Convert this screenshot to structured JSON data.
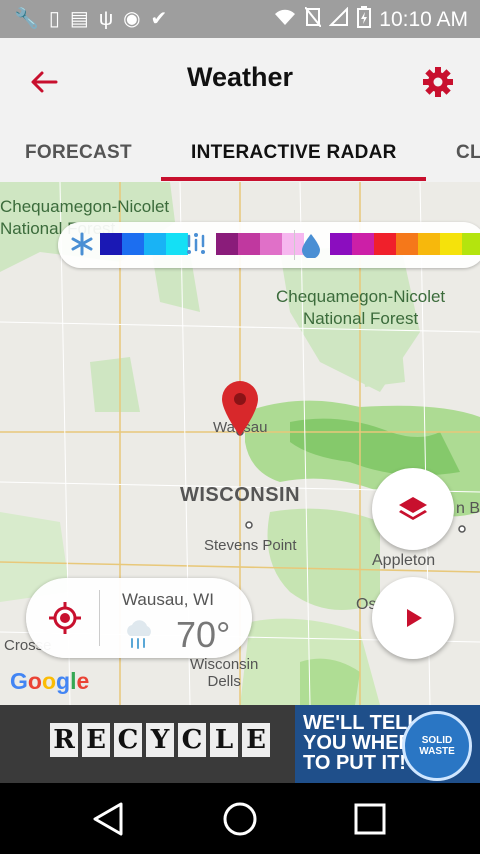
{
  "status_bar": {
    "time": "10:10 AM",
    "left_icons": [
      "wrench-icon",
      "flashlight-icon",
      "storage-100-icon",
      "usb-icon",
      "android-debug-icon",
      "check-icon"
    ],
    "right_icons": [
      "wifi-icon",
      "no-sim-icon",
      "signal-icon",
      "battery-charging-icon"
    ]
  },
  "app_bar": {
    "title": "Weather",
    "back_icon": "back-arrow-icon",
    "settings_icon": "gear-icon",
    "accent": "#c8102e"
  },
  "tabs": [
    {
      "label": "FORECAST",
      "active": false
    },
    {
      "label": "INTERACTIVE RADAR",
      "active": true
    },
    {
      "label": "CL",
      "active": false
    }
  ],
  "map": {
    "labels": {
      "forest_1": "Chequamegon-Nicolet\nNational Forest",
      "forest_2": "Chequamegon-Nicolet\nNational Forest",
      "state": "WISCONSIN",
      "city_wausau": "Wausau",
      "city_stevens_point": "Stevens Point",
      "city_appleton": "Appleton",
      "city_wisconsin_dells": "Wisconsin\nDells",
      "city_crosse": "Crosse",
      "city_os": "Os",
      "city_green_bay_partial": "n B"
    },
    "legend": {
      "snow_icon": "snowflake-icon",
      "snow_colors": [
        "#1a18b4",
        "#1c6ef0",
        "#19b3f5",
        "#14e0f5"
      ],
      "mix_icon": "mixed-precip-icon",
      "mix_colors": [
        "#8a1c7a",
        "#c0389f",
        "#e070c8",
        "#f6b7ef"
      ],
      "rain_icon": "raindrop-icon",
      "rain_colors": [
        "#8b0dbf",
        "#cc1fa7",
        "#f0202b",
        "#f5781a",
        "#f7b80c",
        "#f5e20b",
        "#b4e40e",
        "#36b411"
      ]
    },
    "layers_icon": "layers-icon",
    "play_icon": "play-icon",
    "attribution": "Google",
    "location_pin_icon": "map-pin-icon"
  },
  "weather_card": {
    "location": "Wausau, WI",
    "temperature": "70°",
    "condition_icon": "rain-cloud-icon",
    "locate_icon": "my-location-icon"
  },
  "ad": {
    "word": "RECYCLE",
    "headline": "WE'LL TELL\nYOU WHERE\nTO PUT IT!",
    "seal": "SOLID\nWASTE"
  },
  "nav_bar": {
    "back_icon": "nav-back-icon",
    "home_icon": "nav-home-icon",
    "recents_icon": "nav-recents-icon"
  }
}
